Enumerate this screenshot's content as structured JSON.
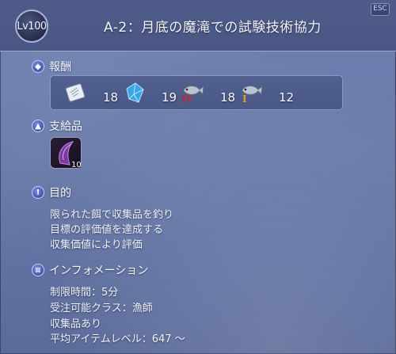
{
  "header": {
    "level": "Lv100",
    "title": "A-2：月底の魔滝での試験技術協力",
    "close_label": "ESC"
  },
  "sections": {
    "reward": {
      "label": "報酬",
      "items": [
        {
          "icon": "scrip-paper-icon",
          "count": "18"
        },
        {
          "icon": "crystal-icon",
          "count": "19"
        },
        {
          "icon": "fish-icon",
          "count": "18",
          "badge": "IV"
        },
        {
          "icon": "fish-icon",
          "count": "12",
          "badge": "I"
        }
      ]
    },
    "supply": {
      "label": "支給品",
      "item": {
        "icon": "bait-icon",
        "count": "10"
      }
    },
    "objective": {
      "label": "目的",
      "lines": [
        "限られた餌で収集品を釣り",
        "目標の評価値を達成する",
        "収集価値により評価"
      ]
    },
    "info": {
      "label": "インフォメーション",
      "lines": [
        "制限時間：5分",
        "受注可能クラス：漁師",
        "収集品あり",
        "平均アイテムレベル：647 ～"
      ]
    }
  },
  "colors": {
    "badge_iv": "#c22a2a",
    "badge_i": "#d9a21a"
  }
}
